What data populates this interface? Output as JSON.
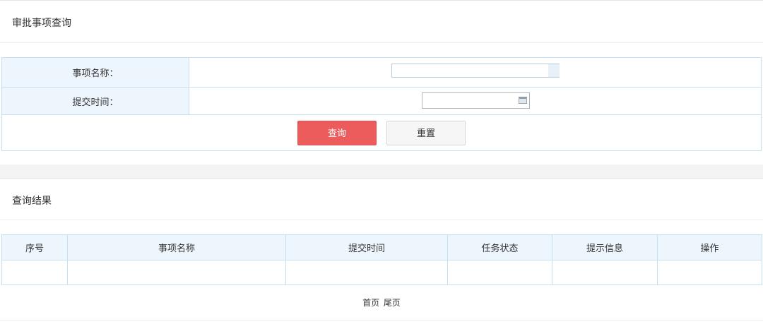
{
  "query_panel": {
    "title": "审批事项查询",
    "name_label": "事项名称：",
    "name_value": "",
    "name_placeholder": "",
    "time_label": "提交时间：",
    "time_value": "",
    "query_button": "查询",
    "reset_button": "重置"
  },
  "results_panel": {
    "title": "查询结果",
    "columns": [
      "序号",
      "事项名称",
      "提交时间",
      "任务状态",
      "提示信息",
      "操作"
    ],
    "rows": [
      [
        "",
        "",
        "",
        "",
        "",
        ""
      ]
    ],
    "pager": {
      "first": "首页",
      "last": "尾页"
    }
  },
  "colors": {
    "query_button_bg": "#ec5c5c",
    "header_bg": "#eef6fd",
    "border": "#c7e0ef"
  }
}
